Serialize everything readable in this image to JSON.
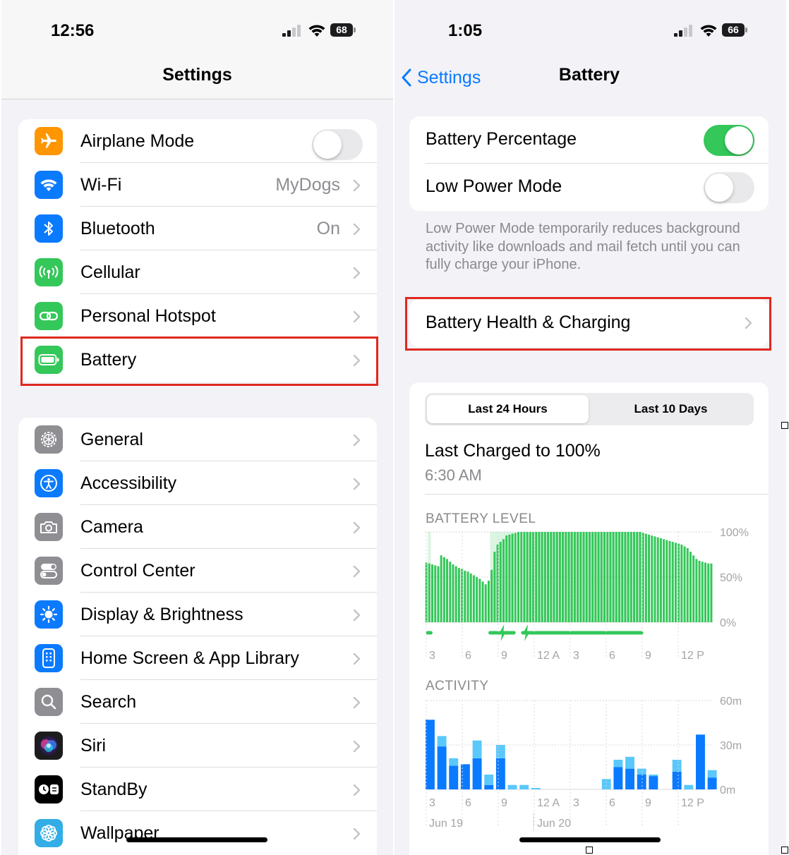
{
  "left": {
    "status": {
      "time": "12:56",
      "battery": "68"
    },
    "title": "Settings",
    "group1": [
      {
        "label": "Airplane Mode",
        "icon": "airplane-icon",
        "color": "#ff9500",
        "toggle": "off"
      },
      {
        "label": "Wi-Fi",
        "value": "MyDogs",
        "icon": "wifi-icon",
        "color": "#0a7aff"
      },
      {
        "label": "Bluetooth",
        "value": "On",
        "icon": "bluetooth-icon",
        "color": "#0a7aff"
      },
      {
        "label": "Cellular",
        "icon": "cellular-icon",
        "color": "#34c759"
      },
      {
        "label": "Personal Hotspot",
        "icon": "hotspot-icon",
        "color": "#34c759"
      },
      {
        "label": "Battery",
        "icon": "battery-icon",
        "color": "#34c759"
      }
    ],
    "group2": [
      {
        "label": "General",
        "icon": "gear-icon",
        "color": "#8e8e93"
      },
      {
        "label": "Accessibility",
        "icon": "accessibility-icon",
        "color": "#0a7aff"
      },
      {
        "label": "Camera",
        "icon": "camera-icon",
        "color": "#8e8e93"
      },
      {
        "label": "Control Center",
        "icon": "control-center-icon",
        "color": "#8e8e93"
      },
      {
        "label": "Display & Brightness",
        "icon": "sun-icon",
        "color": "#0a7aff"
      },
      {
        "label": "Home Screen & App Library",
        "icon": "home-screen-icon",
        "color": "#0a7aff"
      },
      {
        "label": "Search",
        "icon": "search-icon",
        "color": "#8e8e93"
      },
      {
        "label": "Siri",
        "icon": "siri-icon",
        "color": "#1c1c1e"
      },
      {
        "label": "StandBy",
        "icon": "standby-icon",
        "color": "#000000"
      },
      {
        "label": "Wallpaper",
        "icon": "flower-icon",
        "color": "#32ade6"
      }
    ]
  },
  "right": {
    "status": {
      "time": "1:05",
      "battery": "66"
    },
    "back": "Settings",
    "title": "Battery",
    "battery_percentage": "Battery Percentage",
    "low_power_mode": "Low Power Mode",
    "footnote": "Low Power Mode temporarily reduces background activity like downloads and mail fetch until you can fully charge your iPhone.",
    "health_charging": "Battery Health & Charging",
    "tabs": [
      "Last 24 Hours",
      "Last 10 Days"
    ],
    "last_charged": "Last Charged to 100%",
    "last_charged_time": "6:30 AM",
    "battery_level_title": "BATTERY LEVEL",
    "activity_title": "ACTIVITY",
    "x_ticks": [
      "3",
      "6",
      "9",
      "12 A",
      "3",
      "6",
      "9",
      "12 P"
    ],
    "days": [
      "Jun 19",
      "Jun 20"
    ],
    "accent": "#34c759",
    "link_color": "#0a7aff"
  },
  "chart_data": [
    {
      "type": "bar",
      "title": "BATTERY LEVEL",
      "x_ticks": [
        "3",
        "6",
        "9",
        "12 A",
        "3",
        "6",
        "9",
        "12 P"
      ],
      "y_ticks": [
        "100%",
        "50%",
        "0%"
      ],
      "ylim": [
        0,
        100
      ],
      "values": [
        66,
        65,
        64,
        63,
        62,
        74,
        72,
        70,
        67,
        64,
        62,
        60,
        59,
        57,
        56,
        54,
        52,
        50,
        48,
        45,
        42,
        46,
        58,
        78,
        86,
        89,
        92,
        96,
        97,
        98,
        99,
        100,
        100,
        100,
        100,
        100,
        100,
        100,
        100,
        100,
        100,
        100,
        100,
        100,
        100,
        100,
        100,
        100,
        100,
        100,
        100,
        100,
        100,
        100,
        100,
        100,
        100,
        100,
        100,
        100,
        100,
        100,
        100,
        100,
        100,
        100,
        100,
        100,
        100,
        100,
        100,
        100,
        100,
        99,
        98,
        97,
        96,
        95,
        94,
        93,
        92,
        91,
        90,
        89,
        88,
        87,
        86,
        84,
        82,
        78,
        74,
        70,
        68,
        67,
        66,
        65,
        65
      ],
      "charging_periods": [
        [
          1,
          1
        ],
        [
          22,
          29
        ],
        [
          33,
          72
        ]
      ]
    },
    {
      "type": "bar",
      "title": "ACTIVITY",
      "x_ticks": [
        "3",
        "6",
        "9",
        "12 A",
        "3",
        "6",
        "9",
        "12 P"
      ],
      "y_ticks": [
        "60m",
        "30m",
        "0m"
      ],
      "ylim": [
        0,
        60
      ],
      "series": [
        {
          "name": "",
          "values": [
            47,
            0,
            29,
            0,
            16,
            0,
            17,
            0,
            21,
            0,
            3,
            0,
            21,
            0,
            0,
            0,
            0,
            0,
            0,
            0,
            0,
            0,
            0,
            0,
            0,
            0,
            0,
            0,
            0,
            0,
            0,
            0,
            15,
            0,
            14,
            0,
            10,
            0,
            9,
            0,
            0,
            0,
            12,
            0,
            0,
            0,
            37,
            0,
            8
          ]
        },
        {
          "name": "",
          "values": [
            0,
            0,
            7,
            0,
            5,
            0,
            0,
            0,
            12,
            0,
            7,
            0,
            9,
            0,
            3,
            0,
            3,
            0,
            1,
            0,
            0,
            0,
            0,
            0,
            0,
            0,
            0,
            0,
            0,
            0,
            7,
            0,
            5,
            0,
            8,
            0,
            4,
            0,
            1,
            0,
            0,
            0,
            8,
            0,
            3,
            0,
            0,
            0,
            5
          ]
        }
      ]
    }
  ]
}
